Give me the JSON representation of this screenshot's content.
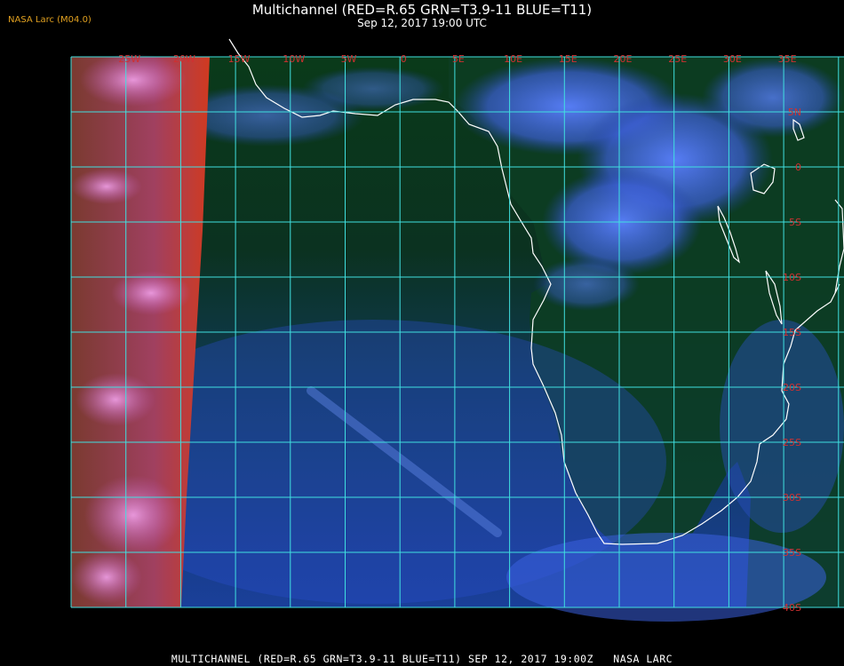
{
  "header": {
    "title": "Multichannel (RED=R.65 GRN=T3.9-11 BLUE=T11)",
    "datetime": "Sep 12, 2017 19:00 UTC",
    "credit": "NASA Larc (M04.0)"
  },
  "footer": {
    "caption": "MULTICHANNEL (RED=R.65 GRN=T3.9-11 BLUE=T11) SEP 12, 2017 19:00Z   NASA LARC"
  },
  "map": {
    "grid_color": "#40e0e0",
    "coast_color": "#ffffff",
    "label_color": "#d03030",
    "longitude_labels": [
      "25W",
      "20W",
      "15W",
      "10W",
      "5W",
      "0",
      "5E",
      "10E",
      "15E",
      "20E",
      "25E",
      "30E",
      "35E"
    ],
    "latitude_labels": [
      "5N",
      "0",
      "5S",
      "10S",
      "15S",
      "20S",
      "25S",
      "30S",
      "35S",
      "40S"
    ]
  }
}
